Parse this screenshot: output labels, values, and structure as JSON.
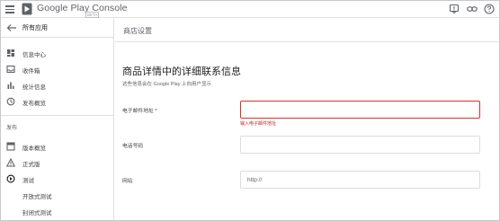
{
  "app": {
    "brand": "Google Play Console",
    "beta_badge": "BETA",
    "icons": [
      "menu-icon",
      "play-logo-icon",
      "notifications-icon",
      "link-icon",
      "help-icon"
    ]
  },
  "sidebar": {
    "back_label": "所有应用",
    "items_top": [
      {
        "label": "信息中心",
        "icon": "dashboard-icon"
      },
      {
        "label": "收件箱",
        "icon": "inbox-icon"
      },
      {
        "label": "统计信息",
        "icon": "bar-chart-icon"
      },
      {
        "label": "发布概览",
        "icon": "publish-overview-icon"
      }
    ],
    "release_section_title": "发布",
    "items_release": [
      {
        "label": "版本概览",
        "icon": "release-overview-icon"
      },
      {
        "label": "正式版",
        "icon": "production-icon"
      },
      {
        "label": "测试",
        "icon": "testing-icon"
      },
      {
        "label": "开放式测试",
        "icon": ""
      },
      {
        "label": "封闭式测试",
        "icon": ""
      }
    ]
  },
  "main": {
    "page_title": "商店设置",
    "section_heading": "商品详情中的详细联系信息",
    "section_desc": "这些信息会在 Google Play 上向用户显示",
    "fields": {
      "email": {
        "label": "电子邮件地址 *",
        "value": "",
        "placeholder": "",
        "error": "输入电子邮件地址"
      },
      "phone": {
        "label": "电话号码",
        "value": "",
        "placeholder": ""
      },
      "website": {
        "label": "网站",
        "value": "http://",
        "placeholder": ""
      }
    }
  },
  "colors": {
    "error": "#d93025",
    "border": "#dadce0",
    "text": "#202124",
    "muted": "#5f6368"
  }
}
